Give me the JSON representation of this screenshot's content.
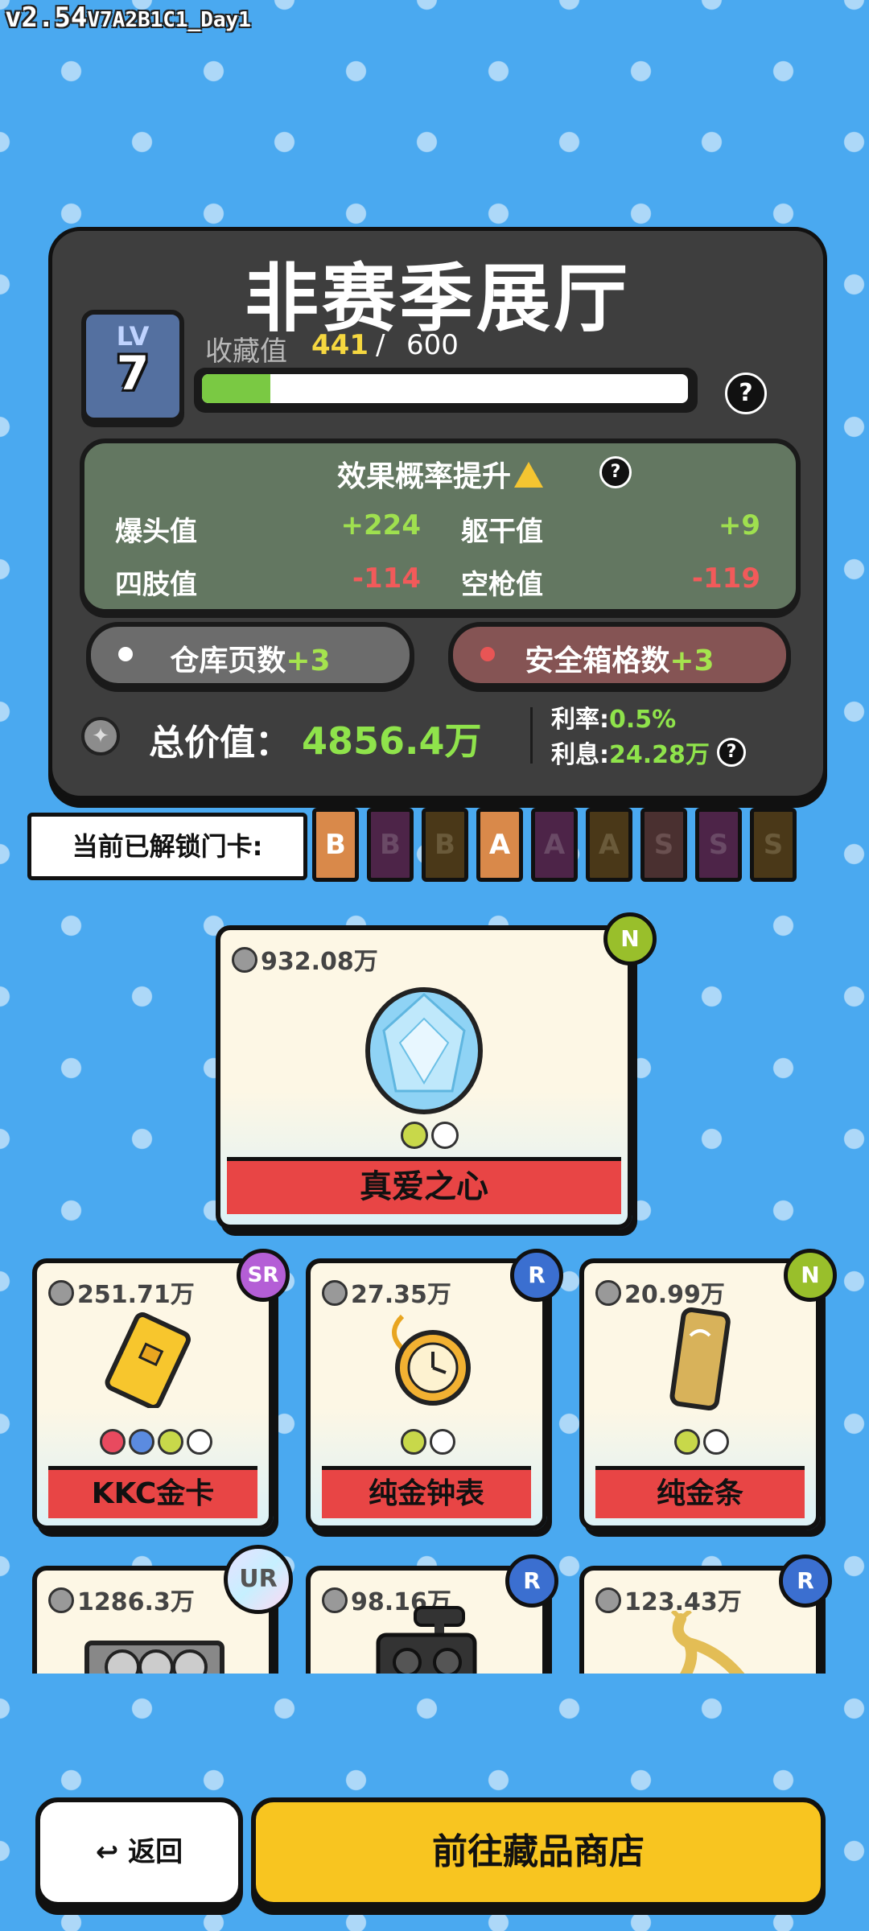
{
  "version": {
    "main": "v2.54",
    "build": "V7A2B1C1_Day1"
  },
  "hall": {
    "title": "非赛季展厅",
    "level_label": "LV",
    "level": "7",
    "collection_label": "收藏值",
    "collection_current": "441",
    "collection_sep": "/",
    "collection_max": "600",
    "collection_progress": 0.14,
    "help_symbol": "?"
  },
  "effects": {
    "title": "效果概率提升",
    "stats": [
      {
        "name": "爆头值",
        "value": "+224",
        "sign": "pos"
      },
      {
        "name": "躯干值",
        "value": "+9",
        "sign": "pos"
      },
      {
        "name": "四肢值",
        "value": "-114",
        "sign": "neg"
      },
      {
        "name": "空枪值",
        "value": "-119",
        "sign": "neg"
      }
    ]
  },
  "bonuses": {
    "warehouse_label": "仓库页数",
    "warehouse_bonus": "+3",
    "safe_label": "安全箱格数",
    "safe_bonus": "+3"
  },
  "total": {
    "label": "总价值：",
    "value": "4856.4万",
    "rate_label": "利率:",
    "rate_value": "0.5%",
    "interest_label": "利息:",
    "interest_value": "24.28万"
  },
  "keycards": {
    "label": "当前已解锁门卡:",
    "items": [
      {
        "letter": "B",
        "color": "#d9894a",
        "text": "#ffffff"
      },
      {
        "letter": "B",
        "color": "#4d2448",
        "text": "#6a4a66"
      },
      {
        "letter": "B",
        "color": "#4a3818",
        "text": "#6a5a3a"
      },
      {
        "letter": "A",
        "color": "#d9894a",
        "text": "#ffffff"
      },
      {
        "letter": "A",
        "color": "#4d2448",
        "text": "#6a4a66"
      },
      {
        "letter": "A",
        "color": "#4a3818",
        "text": "#6a5a3a"
      },
      {
        "letter": "S",
        "color": "#4a3030",
        "text": "#6a5050"
      },
      {
        "letter": "S",
        "color": "#4d2448",
        "text": "#6a4a66"
      },
      {
        "letter": "S",
        "color": "#4a3818",
        "text": "#6a5a3a"
      }
    ]
  },
  "featured": {
    "price": "932.08万",
    "rarity": "N",
    "name": "真爱之心",
    "icon": "diamond-heart"
  },
  "items": [
    {
      "price": "251.71万",
      "rarity": "SR",
      "name": "KKC金卡",
      "icon": "gold-card-icon"
    },
    {
      "price": "27.35万",
      "rarity": "R",
      "name": "纯金钟表",
      "icon": "pocket-watch-icon"
    },
    {
      "price": "20.99万",
      "rarity": "N",
      "name": "纯金条",
      "icon": "gold-bar-icon"
    },
    {
      "price": "1286.3万",
      "rarity": "UR",
      "name": "",
      "icon": "graphics-card-icon"
    },
    {
      "price": "98.16万",
      "rarity": "R",
      "name": "",
      "icon": "camera-icon"
    },
    {
      "price": "123.43万",
      "rarity": "R",
      "name": "",
      "icon": "golden-deer-icon"
    }
  ],
  "buttons": {
    "back": "返回",
    "shop": "前往藏品商店"
  },
  "colors": {
    "accent_green": "#8fe34b",
    "negative_red": "#f25a5a",
    "shop_yellow": "#f8c520"
  }
}
